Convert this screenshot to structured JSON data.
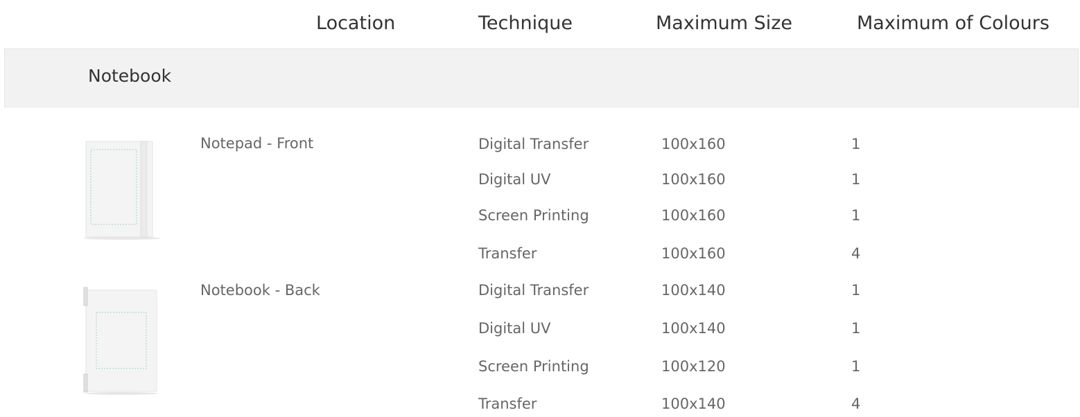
{
  "headers": {
    "location": "Location",
    "technique": "Technique",
    "max_size": "Maximum Size",
    "max_colours": "Maximum of Colours"
  },
  "group": {
    "title": "Notebook"
  },
  "items": [
    {
      "location": "Notepad - Front",
      "thumbnail_icon": "notebook-front-thumbnail",
      "rows": [
        {
          "technique": "Digital Transfer",
          "size": "100x160",
          "colours": "1"
        },
        {
          "technique": "Digital UV",
          "size": "100x160",
          "colours": "1"
        },
        {
          "technique": "Screen Printing",
          "size": "100x160",
          "colours": "1"
        },
        {
          "technique": "Transfer",
          "size": "100x160",
          "colours": "4"
        }
      ]
    },
    {
      "location": "Notebook - Back",
      "thumbnail_icon": "notebook-back-thumbnail",
      "rows": [
        {
          "technique": "Digital Transfer",
          "size": "100x140",
          "colours": "1"
        },
        {
          "technique": "Digital UV",
          "size": "100x140",
          "colours": "1"
        },
        {
          "technique": "Screen Printing",
          "size": "100x120",
          "colours": "1"
        },
        {
          "technique": "Transfer",
          "size": "100x140",
          "colours": "4"
        }
      ]
    }
  ],
  "colors": {
    "band": "#f2f2f2",
    "print_area_outline": "#9fd3c7"
  }
}
